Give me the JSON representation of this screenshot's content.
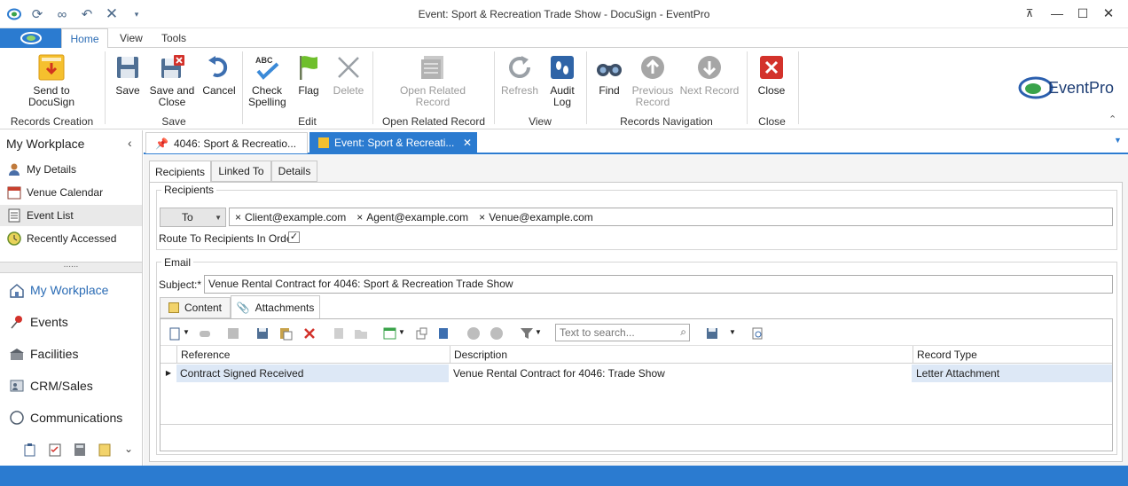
{
  "window": {
    "title": "Event: Sport & Recreation Trade Show - DocuSign - EventPro"
  },
  "menu": {
    "tabs": [
      "Home",
      "View",
      "Tools"
    ]
  },
  "ribbon": {
    "buttons": {
      "send_docusign": "Send to DocuSign",
      "save": "Save",
      "save_close": "Save and Close",
      "cancel": "Cancel",
      "check_spelling": "Check Spelling",
      "flag": "Flag",
      "delete": "Delete",
      "open_related": "Open Related Record",
      "refresh": "Refresh",
      "audit_log": "Audit Log",
      "find": "Find",
      "previous": "Previous Record",
      "next": "Next Record",
      "close": "Close"
    },
    "groups": {
      "records_creation": "Records Creation",
      "save": "Save",
      "edit": "Edit",
      "open_related": "Open Related Record",
      "view": "View",
      "records_navigation": "Records Navigation",
      "close": "Close"
    },
    "logo": "EventPro"
  },
  "sidebar": {
    "title": "My Workplace",
    "items": [
      "My Details",
      "Venue Calendar",
      "Event List",
      "Recently Accessed"
    ],
    "selected": "Event List",
    "nav": [
      "My Workplace",
      "Events",
      "Facilities",
      "CRM/Sales",
      "Communications"
    ],
    "splitter": "......"
  },
  "doc_tabs": [
    {
      "label": "4046: Sport & Recreatio..."
    },
    {
      "label": "Event: Sport & Recreati..."
    }
  ],
  "form": {
    "tabs": [
      "Recipients",
      "Linked To",
      "Details"
    ],
    "recipients_group": "Recipients",
    "to_label": "To",
    "recipients": [
      "Client@example.com",
      "Agent@example.com",
      "Venue@example.com"
    ],
    "route_label": "Route To Recipients In Order",
    "route_checked": true,
    "email_group": "Email",
    "subject_label": "Subject:*",
    "subject_value": "Venue Rental Contract for 4046: Sport & Recreation Trade Show",
    "email_tabs": [
      "Content",
      "Attachments"
    ],
    "search_placeholder": "Text to search...",
    "grid": {
      "columns": [
        "Reference",
        "Description",
        "Record Type"
      ],
      "rows": [
        [
          "Contract Signed Received",
          "Venue Rental Contract for 4046: Trade Show",
          "Letter Attachment"
        ]
      ]
    }
  },
  "colors": {
    "accent": "#2b7bd0",
    "brand_green": "#3aa34a"
  }
}
